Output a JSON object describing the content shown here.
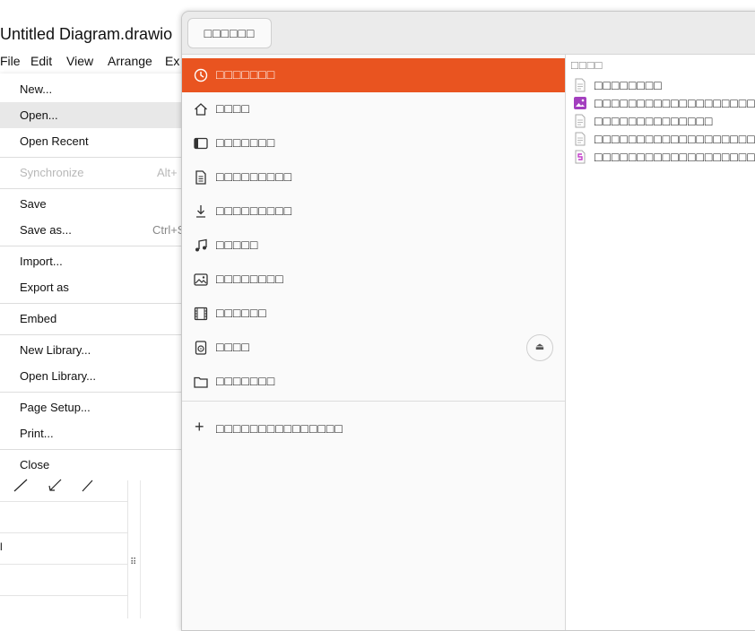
{
  "app": {
    "title": "Untitled Diagram.drawio",
    "menubar": [
      "File",
      "Edit",
      "View",
      "Arrange",
      "Ex"
    ]
  },
  "file_menu": {
    "items": [
      {
        "label": "New...",
        "shortcut": ""
      },
      {
        "label": "Open...",
        "shortcut": ""
      },
      {
        "label": "Open Recent",
        "shortcut": ""
      },
      {
        "label": "Synchronize",
        "shortcut": "Alt+"
      },
      {
        "label": "Save",
        "shortcut": ""
      },
      {
        "label": "Save as...",
        "shortcut": "Ctrl+S"
      },
      {
        "label": "Import...",
        "shortcut": ""
      },
      {
        "label": "Export as",
        "shortcut": ""
      },
      {
        "label": "Embed",
        "shortcut": ""
      },
      {
        "label": "New Library...",
        "shortcut": ""
      },
      {
        "label": "Open Library...",
        "shortcut": ""
      },
      {
        "label": "Page Setup...",
        "shortcut": ""
      },
      {
        "label": "Print...",
        "shortcut": ""
      },
      {
        "label": "Close",
        "shortcut": ""
      }
    ],
    "highlighted": "Open...",
    "disabled": "Synchronize"
  },
  "lower_panel": {
    "cut_label": "l",
    "drag_handle": "⠿"
  },
  "dialog": {
    "header_button": "□□□□□□",
    "places": [
      {
        "label": "□□□□□□□",
        "icon": "recent-icon"
      },
      {
        "label": "□□□□",
        "icon": "home-icon"
      },
      {
        "label": "□□□□□□□",
        "icon": "desktop-icon"
      },
      {
        "label": "□□□□□□□□□",
        "icon": "document-icon"
      },
      {
        "label": "□□□□□□□□□",
        "icon": "download-icon"
      },
      {
        "label": "□□□□□",
        "icon": "music-icon"
      },
      {
        "label": "□□□□□□□□",
        "icon": "picture-icon"
      },
      {
        "label": "□□□□□□",
        "icon": "video-icon"
      },
      {
        "label": "□□□□",
        "icon": "drive-icon"
      },
      {
        "label": "□□□□□□□",
        "icon": "folder-icon"
      }
    ],
    "eject_glyph": "⏏",
    "add_location": "□□□□□□□□□□□□□□□",
    "files_column_header": "□□□□",
    "files": [
      {
        "label": "□□□□□□□□",
        "icon": "text-file-icon"
      },
      {
        "label": "□□□□□□□□□□□□□□□□□□□□□",
        "icon": "image-file-icon"
      },
      {
        "label": "□□□□□□□□□□□□□□",
        "icon": "text-file-icon"
      },
      {
        "label": "□□□□□□□□□□□□□□□□□□□□□",
        "icon": "text-file-icon"
      },
      {
        "label": "□□□□□□□□□□□□□□□□□□□□□",
        "icon": "diagram-file-icon"
      }
    ]
  },
  "colors": {
    "selected_place": "#e95420",
    "image_file_icon": "#a33fbf",
    "diagram_file_icon": "#c23bc9"
  }
}
